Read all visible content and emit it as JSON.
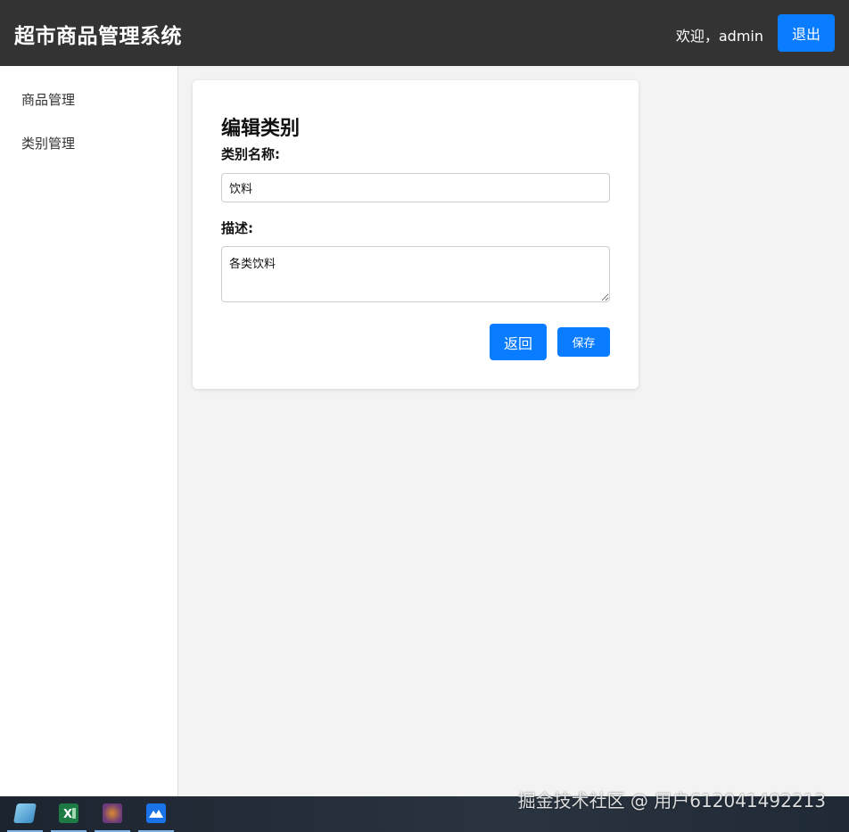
{
  "header": {
    "title": "超市商品管理系统",
    "welcome": "欢迎，admin",
    "logout_label": "退出"
  },
  "sidebar": {
    "items": [
      {
        "label": "商品管理"
      },
      {
        "label": "类别管理"
      }
    ]
  },
  "form": {
    "title": "编辑类别",
    "name_label": "类别名称:",
    "name_value": "饮料",
    "desc_label": "描述:",
    "desc_value": "各类饮料",
    "back_label": "返回",
    "save_label": "保存"
  },
  "taskbar": {
    "apps": [
      {
        "icon": "notepad-icon"
      },
      {
        "icon": "excel-icon"
      },
      {
        "icon": "game-icon"
      },
      {
        "icon": "mountain-app-icon"
      }
    ]
  },
  "watermark": "掘金技术社区 @ 用户612041492213",
  "colors": {
    "header_bg": "#333333",
    "accent": "#0a7cff",
    "page_bg": "#f3f3f3"
  }
}
